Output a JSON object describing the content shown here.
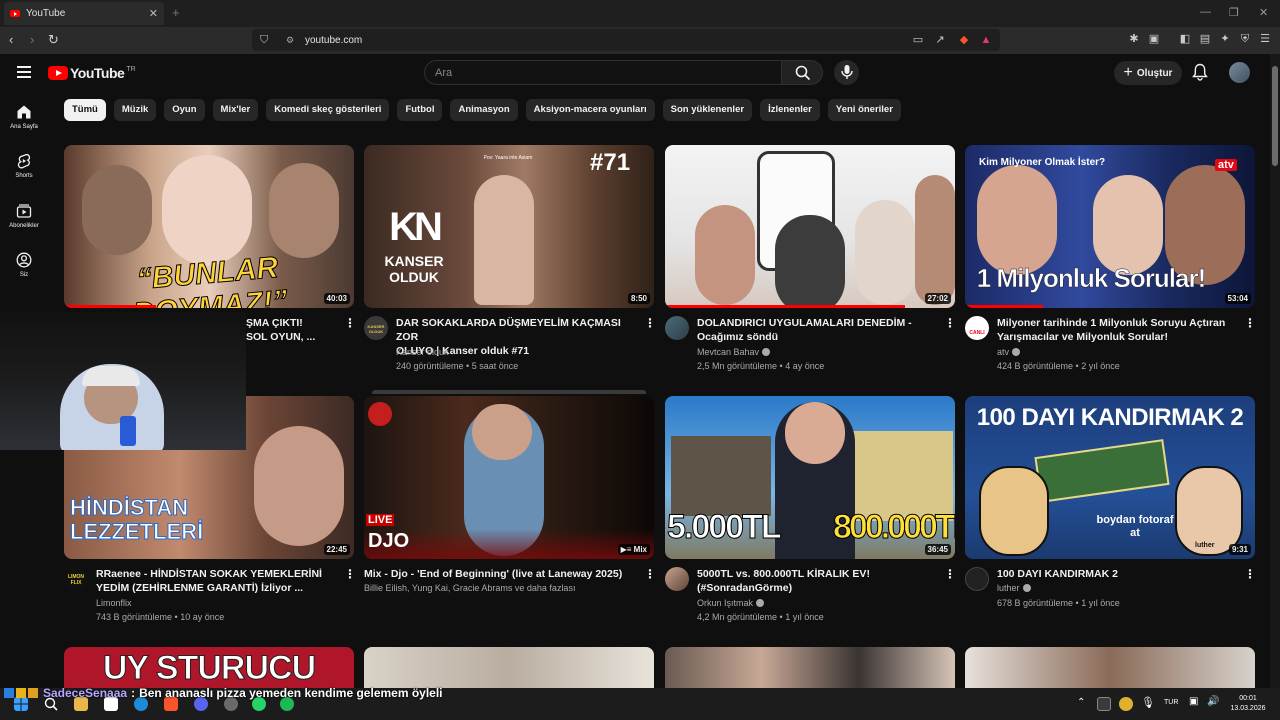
{
  "browser": {
    "tab_title": "YouTube",
    "tab_close": "✕",
    "new_tab": "+",
    "url": "youtube.com"
  },
  "header": {
    "logo_text": "YouTube",
    "country": "TR",
    "search_placeholder": "Ara",
    "create_label": "Oluştur",
    "create_plus": "+"
  },
  "sidebar": {
    "items": [
      {
        "label": "Ana Sayfa",
        "icon": "home-icon"
      },
      {
        "label": "Shorts",
        "icon": "shorts-icon"
      },
      {
        "label": "Abonelikler",
        "icon": "subscriptions-icon"
      },
      {
        "label": "Siz",
        "icon": "you-icon"
      }
    ]
  },
  "chips": [
    "Tümü",
    "Müzik",
    "Oyun",
    "Mix'ler",
    "Komedi skeç gösterileri",
    "Futbol",
    "Animasyon",
    "Aksiyon-macera oyunları",
    "Son yüklenenler",
    "İzlenenler",
    "Yeni öneriler"
  ],
  "videos": [
    {
      "title_1": "ŞMA ÇIKTI!",
      "title_2": "SOL OYUN, ...",
      "duration": "40:03",
      "thumb_text": "“BUNLAR DOYMAZ!”"
    },
    {
      "title_1": "DAR SOKAKLARDA DÜŞMEYELİM KAÇMASI ZOR",
      "title_2": "OLUYO | Kanser olduk #71",
      "channel": "Kanser olduk",
      "stats": "240 görüntüleme • 5 saat önce",
      "duration": "8:50",
      "thumb_text": "KANSER OLDUK",
      "thumb_num": "#71",
      "thumb_caption": "Pov: Yaara inte Asiam",
      "avatar_text": "KANSER OLDUK"
    },
    {
      "title_1": "DOLANDIRICI UYGULAMALARI DENEDİM -",
      "title_2": "Ocağımız söndü",
      "channel": "Mevtcan Bahav",
      "stats": "2,5 Mn görüntüleme • 4 ay önce",
      "duration": "27:02"
    },
    {
      "title_1": "Milyoner tarihinde 1 Milyonluk Soruyu Açtıran",
      "title_2": "Yarışmacılar ve Milyonluk Sorular!",
      "channel": "atv",
      "stats": "424 B görüntüleme • 2 yıl önce",
      "duration": "53:04",
      "thumb_text": "1 Milyonluk Sorular!",
      "thumb_top": "Kim Milyoner Olmak İster?",
      "thumb_brand": "atv",
      "avatar_text": "CANLI"
    },
    {
      "title_1": "RRaenee - HİNDİSTAN SOKAK YEMEKLERİNİ",
      "title_2": "YEDİM (ZEHİRLENME GARANTİ) İzliyor ...",
      "channel": "Limonflix",
      "stats": "743 B görüntüleme • 10 ay önce",
      "duration": "22:45",
      "thumb_text": "HİNDİSTAN LEZZETLERİ",
      "avatar_text": "LIMON FLIX"
    },
    {
      "title_1": "Mix - Djo - 'End of Beginning' (live at Laneway 2025)",
      "channel": "Billie Eilish, Yung Kai, Gracie Abrams ve daha fazlası",
      "badge": "Mix",
      "thumb_live": "LIVE",
      "thumb_text": "DJO"
    },
    {
      "title_1": "5000TL vs. 800.000TL KİRALIK EV!",
      "title_2": "(#SonradanGörme)",
      "channel": "Orkun Işıtmak",
      "stats": "4,2 Mn görüntüleme • 1 yıl önce",
      "duration": "36:45",
      "thumb_left": "5.000TL",
      "thumb_right": "800.000TL"
    },
    {
      "title_1": "100 DAYI KANDIRMAK 2",
      "channel": "luther",
      "stats": "678 B görüntüleme • 1 yıl önce",
      "duration": "9:31",
      "thumb_text": "100 DAYI KANDIRMAK 2",
      "thumb_caption": "boydan fotoraf at",
      "thumb_sign": "luther"
    }
  ],
  "row3_text": "UY STURUCU",
  "overlay": {
    "chat_user": "SadeceSenaaa",
    "chat_sep": ":",
    "chat_msg": "Ben ananaslı pizza yemeden kendime gelemem öyleli"
  },
  "taskbar": {
    "lang": "TUR",
    "time": "00:01",
    "date": "13.03.2026"
  },
  "colors": {
    "accent": "#ff0000",
    "bg": "#0f0f0f",
    "chip": "#272727"
  }
}
